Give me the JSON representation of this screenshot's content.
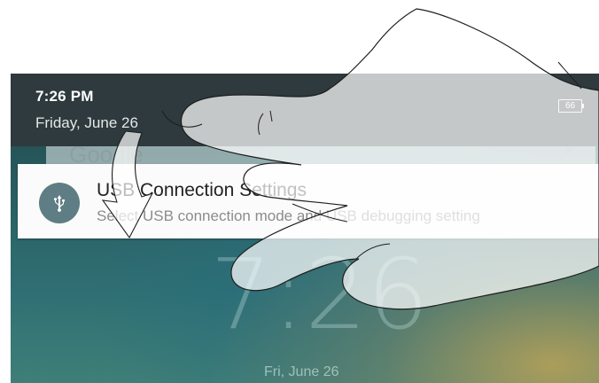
{
  "status_bar": {
    "time": "7:26 PM",
    "date": "Friday, June 26",
    "battery": "66"
  },
  "search_bar": {
    "text": "Google",
    "icon": "mic-icon"
  },
  "notification": {
    "icon": "usb-icon",
    "title": "USB Connection Settings",
    "body": "Select USB connection mode and USB debugging setting"
  },
  "lock_screen": {
    "clock": "7:26",
    "date": "Fri, June 26"
  },
  "overlay": {
    "gesture_icon": "swipe-down-hand-icon"
  },
  "colors": {
    "status_bar": "#2e3a3d",
    "notification_bg": "#fbfbfb",
    "usb_icon_bg": "#5f7d84",
    "wallpaper": "#2b6266"
  }
}
